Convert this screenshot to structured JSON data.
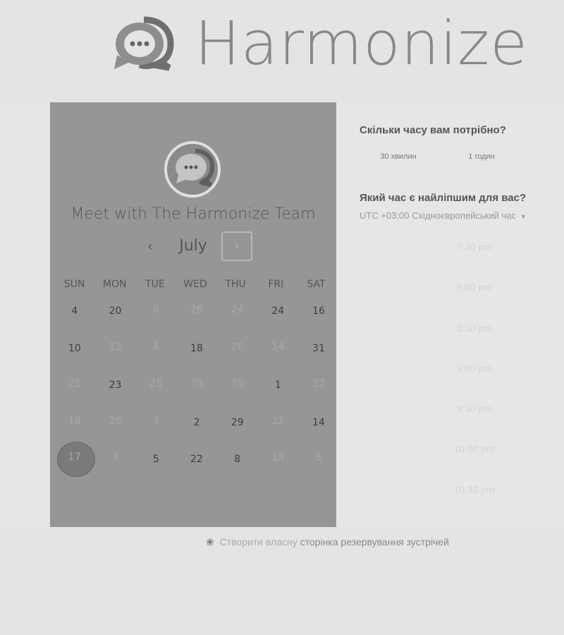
{
  "brand": {
    "name": "Harmonize"
  },
  "card": {
    "heading": "Meet with The Harmonize Team",
    "month": "July",
    "prev_icon": "chevron-left-icon",
    "next_icon": "chevron-right-icon",
    "weekdays": [
      "SUN",
      "MON",
      "TUE",
      "WED",
      "THU",
      "FRI",
      "SAT"
    ],
    "weeks": [
      [
        {
          "d": "4",
          "dim": false
        },
        {
          "d": "20",
          "dim": false
        },
        {
          "d": "6",
          "dim": true
        },
        {
          "d": "26",
          "dim": true
        },
        {
          "d": "24",
          "dim": true
        },
        {
          "d": "24",
          "dim": false
        },
        {
          "d": "16",
          "dim": false
        }
      ],
      [
        {
          "d": "10",
          "dim": false
        },
        {
          "d": "13",
          "dim": true
        },
        {
          "d": "4",
          "dim": true
        },
        {
          "d": "18",
          "dim": false
        },
        {
          "d": "26",
          "dim": true
        },
        {
          "d": "14",
          "dim": true
        },
        {
          "d": "31",
          "dim": false
        }
      ],
      [
        {
          "d": "25",
          "dim": true
        },
        {
          "d": "23",
          "dim": false
        },
        {
          "d": "25",
          "dim": true
        },
        {
          "d": "30",
          "dim": true
        },
        {
          "d": "30",
          "dim": true
        },
        {
          "d": "1",
          "dim": false
        },
        {
          "d": "22",
          "dim": true
        }
      ],
      [
        {
          "d": "18",
          "dim": true
        },
        {
          "d": "26",
          "dim": true
        },
        {
          "d": "3",
          "dim": true
        },
        {
          "d": "2",
          "dim": false
        },
        {
          "d": "29",
          "dim": false
        },
        {
          "d": "22",
          "dim": true
        },
        {
          "d": "14",
          "dim": false
        }
      ],
      [
        {
          "d": "17",
          "dim": false,
          "selected": true
        },
        {
          "d": "7",
          "dim": true
        },
        {
          "d": "5",
          "dim": false
        },
        {
          "d": "22",
          "dim": false
        },
        {
          "d": "8",
          "dim": false
        },
        {
          "d": "19",
          "dim": true
        },
        {
          "d": "5",
          "dim": true
        }
      ]
    ]
  },
  "panel": {
    "duration_question": "Скільки часу вам потрібно?",
    "durations": [
      "30 хвилин",
      "1 годин"
    ],
    "time_question": "Який час є найліпшим для вас?",
    "timezone": "UTC +03:00 Східноєвропейський час",
    "slots": [
      "7:30 pm",
      "8:00 pm",
      "8:30 pm",
      "9:00 pm",
      "9:30 pm",
      "10:00 pm",
      "10:30 pm"
    ]
  },
  "footer": {
    "prefix": "Створити власну",
    "link": "сторінка резервування зустрічей"
  }
}
